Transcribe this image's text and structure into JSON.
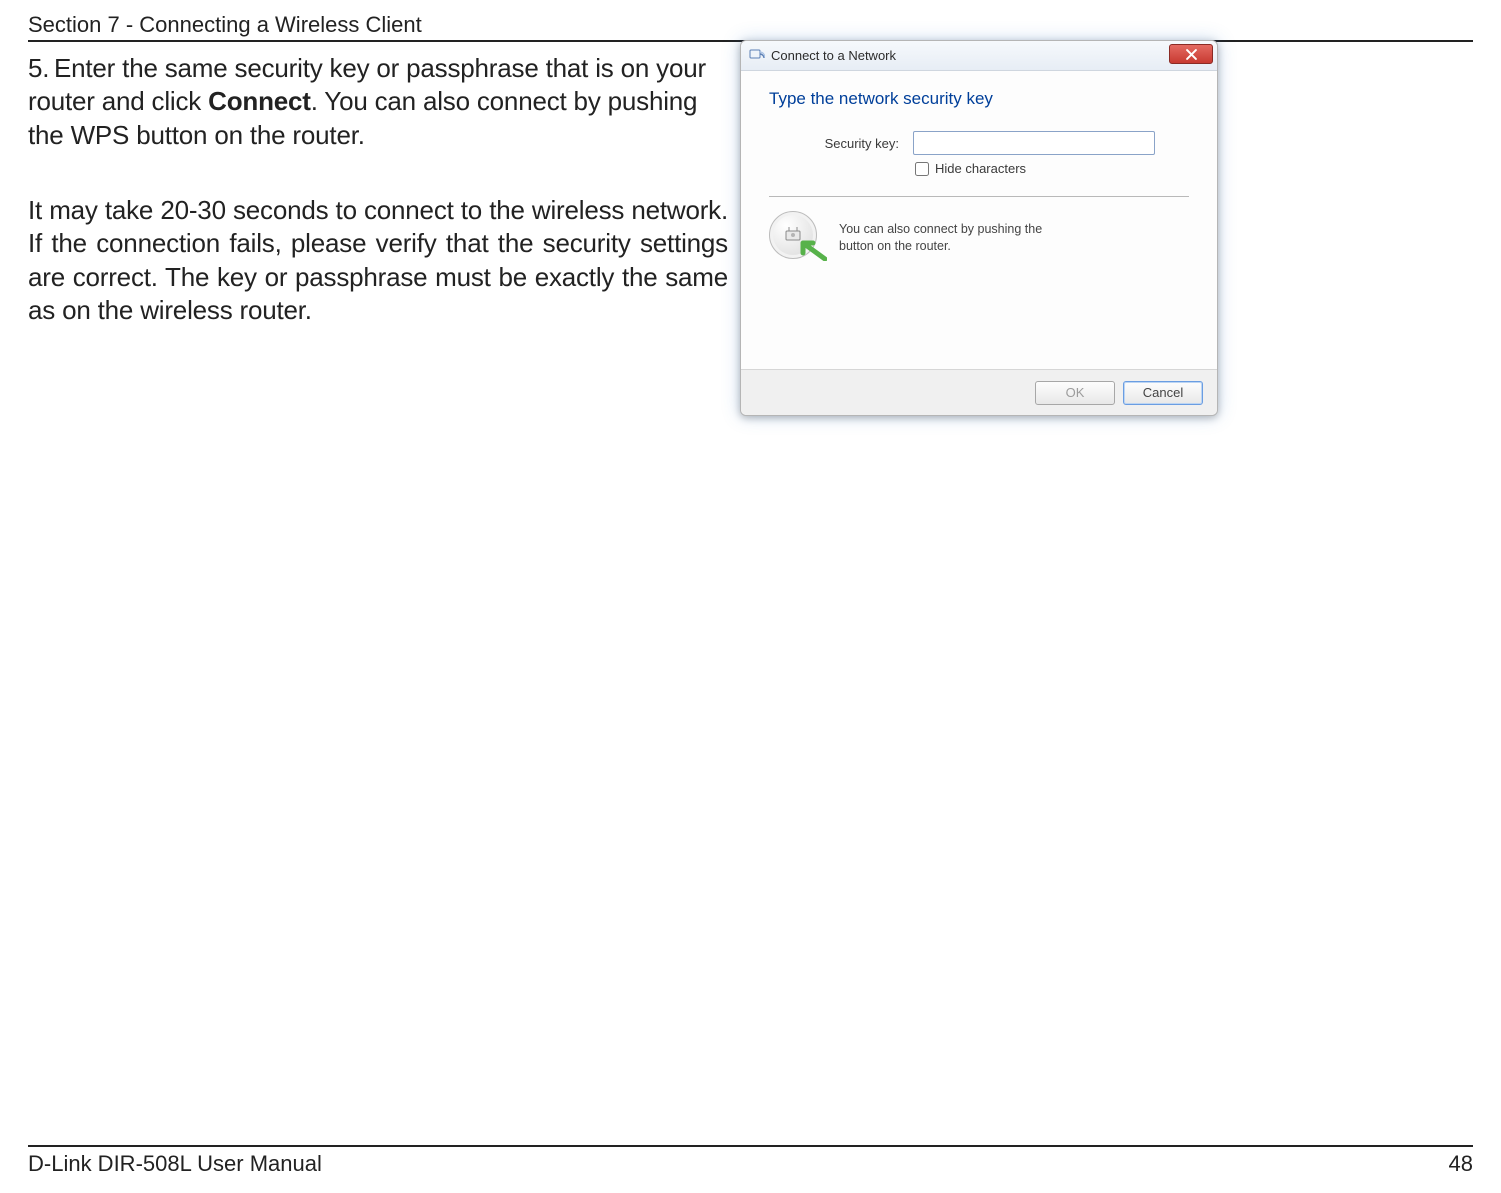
{
  "header": "Section 7 - Connecting a Wireless Client",
  "step5": {
    "num": "5.",
    "textA": "Enter the same security key or passphrase that is on your router and click ",
    "bold": "Connect",
    "textB": ". You can also connect by pushing the WPS button on the router."
  },
  "para2": "It may take 20-30 seconds to connect to the wireless network. If the connection fails, please verify that the security settings are correct. The key or passphrase must be exactly the same as on the wireless router.",
  "dialog": {
    "title": "Connect to a Network",
    "heading": "Type the network security key",
    "fieldLabel": "Security key:",
    "fieldValue": "",
    "hideChars": "Hide characters",
    "hintLine1": "You can also connect by pushing the",
    "hintLine2": "button on the router.",
    "ok": "OK",
    "cancel": "Cancel"
  },
  "footer": {
    "left": "D-Link DIR-508L User Manual",
    "page": "48"
  }
}
